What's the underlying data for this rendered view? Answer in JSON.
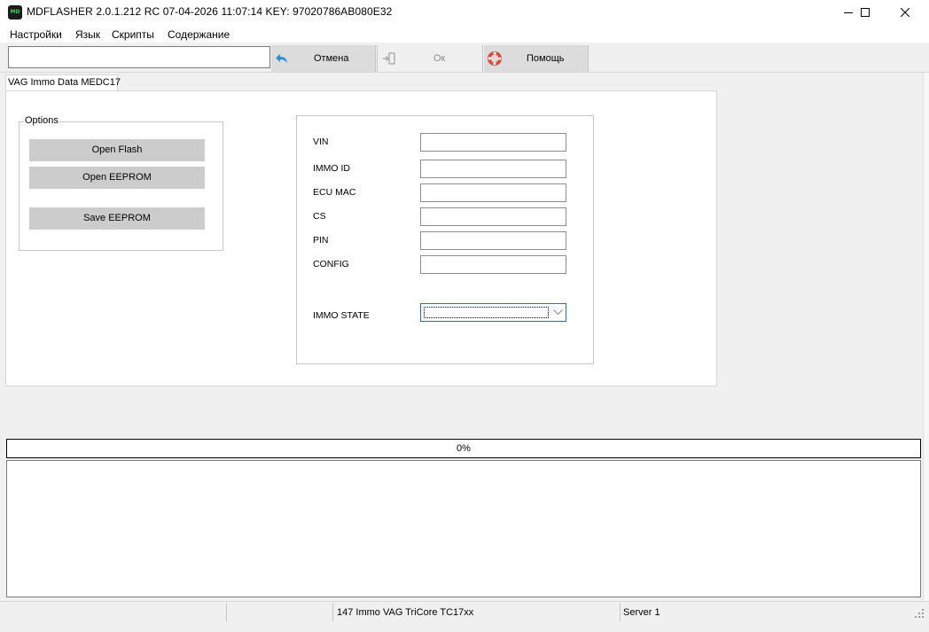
{
  "window": {
    "icon_label": "MD",
    "title": "MDFLASHER  2.0.1.212 RC 07-04-2026 11:07:14  KEY: 97020786AB080E32",
    "controls": [
      "minimize-icon",
      "maximize-icon",
      "close-icon"
    ]
  },
  "menu": {
    "items": [
      "Настройки",
      "Язык",
      "Скрипты",
      "Содержание"
    ]
  },
  "toolbar": {
    "path_value": "",
    "cancel_label": "Отмена",
    "ok_label": "Ок",
    "help_label": "Помощь",
    "cancel_icon_color": "#2b8fd6",
    "help_icon_color": "#e24b3b"
  },
  "tab": {
    "label": "VAG Immo Data MEDC17"
  },
  "options": {
    "legend": "Options",
    "open_flash": "Open Flash",
    "open_eeprom": "Open EEPROM",
    "save_eeprom": "Save EEPROM"
  },
  "fields": {
    "vin": {
      "label": "VIN",
      "value": ""
    },
    "immo_id": {
      "label": "IMMO ID",
      "value": ""
    },
    "ecu_mac": {
      "label": "ECU MAC",
      "value": ""
    },
    "cs": {
      "label": "CS",
      "value": ""
    },
    "pin": {
      "label": "PIN",
      "value": ""
    },
    "config": {
      "label": "CONFIG",
      "value": ""
    },
    "immo_state": {
      "label": "IMMO STATE",
      "value": ""
    }
  },
  "progress": {
    "text": "0%",
    "value": 0
  },
  "status": {
    "cell1": "",
    "cell2": "",
    "module": "147 Immo VAG TriCore TC17xx",
    "server": "Server 1"
  },
  "colors": {
    "accent_focus": "#1e6fd9",
    "button_face": "#cccccc",
    "toolbar_button": "#dcdcdc"
  }
}
